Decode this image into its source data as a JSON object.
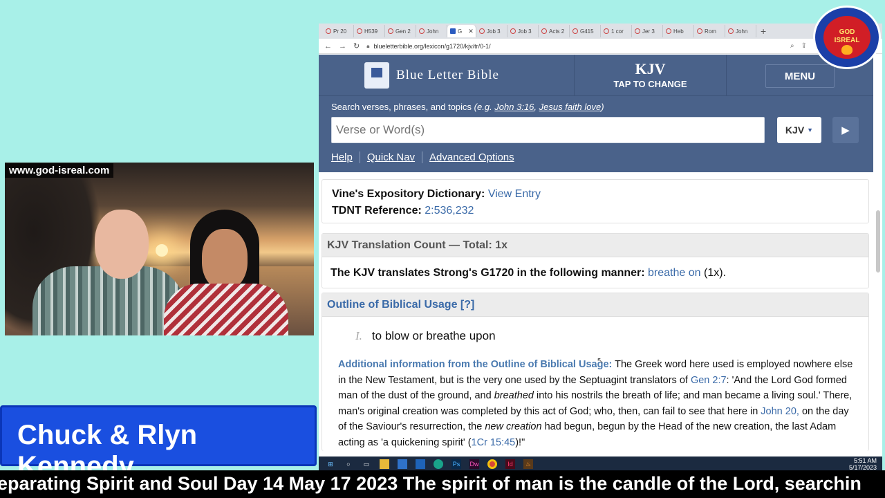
{
  "webcam": {
    "url_overlay": "www.god-isreal.com"
  },
  "banner": {
    "name": "Chuck & Rlyn Kennedy"
  },
  "ticker": {
    "text": "eparating Spirit and Soul Day 14 May 17 2023 The spirit of man is the candle of the Lord, searchin"
  },
  "logo": {
    "line1": "GOD",
    "line2": "ISREAL"
  },
  "browser": {
    "tabs": [
      "Pr 20",
      "H539",
      "Gen 2",
      "John",
      "G",
      "Job 3",
      "Job 3",
      "Acts 2",
      "G415",
      "1 cor",
      "Jer 3",
      "Heb",
      "Rom",
      "John"
    ],
    "active_tab_index": 4,
    "url": "blueletterbible.org/lexicon/g1720/kjv/tr/0-1/"
  },
  "blb": {
    "logo_text": "Blue Letter Bible",
    "version": "KJV",
    "tap_to_change": "TAP TO CHANGE",
    "menu": "MENU",
    "search_prefix": "Search verses, phrases, and topics ",
    "search_eg": "(e.g. ",
    "example1": "John 3:16",
    "example_sep": ", ",
    "example2": "Jesus faith love",
    "search_close": ")",
    "input_placeholder": "Verse or Word(s)",
    "version_select": "KJV",
    "links": [
      "Help",
      "Quick Nav",
      "Advanced Options"
    ]
  },
  "entry": {
    "vines_label": "Vine's Expository Dictionary:",
    "vines_link": "View Entry",
    "tdnt_label": "TDNT Reference:",
    "tdnt_value": "2:536,232",
    "translation_count_head": "KJV Translation Count — Total: 1x",
    "translates_text": "The KJV translates Strong's G1720 in the following manner:",
    "translates_link": "breathe on",
    "translates_count": "(1x).",
    "outline_head": "Outline of Biblical Usage [?]",
    "outline_num": "I.",
    "outline_item": "to blow or breathe upon",
    "addl_head": "Additional information from the Outline of Biblical Usage:",
    "addl_p1": " The Greek word here used is employed nowhere else in the New Testament, but is the very one used by the Septuagint translators of ",
    "ref_gen": "Gen 2:7",
    "addl_p2": ": 'And the Lord God formed man of the dust of the ground, and ",
    "addl_breathed": "breathed",
    "addl_p3": " into his nostrils the breath of life; and man became a living soul.' There, man's original creation was completed by this act of God; who, then, can fail to see that here in ",
    "ref_john": "John 20,",
    "addl_p4": " on the day of the Saviour's resurrection, the ",
    "addl_newcreation": "new creation",
    "addl_p5": " had begun, begun by the Head of the new creation, the last Adam acting as 'a quickening spirit' (",
    "ref_1cr": "1Cr 15:45",
    "addl_p6": ")!\""
  },
  "taskbar": {
    "time": "5:51 AM",
    "date": "5/17/2023"
  }
}
